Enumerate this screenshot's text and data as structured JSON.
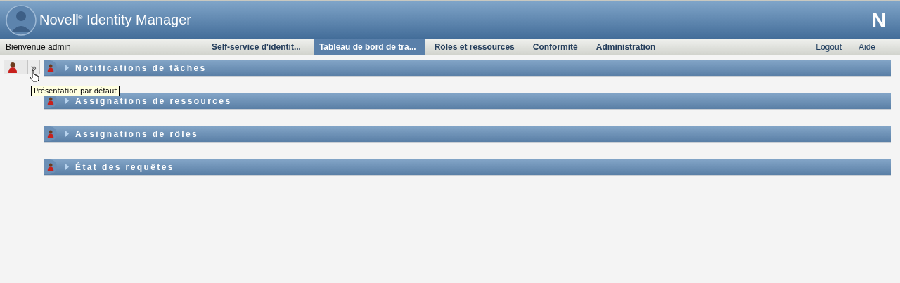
{
  "header": {
    "title": "Novell$^{®}$ Identity Manager",
    "logo_letter": "N"
  },
  "nav": {
    "welcome": "Bienvenue admin",
    "tabs": [
      {
        "label": "Self-service d'identit...",
        "selected": false
      },
      {
        "label": "Tableau de bord de tra...",
        "selected": true
      },
      {
        "label": "Rôles et ressources",
        "selected": false
      },
      {
        "label": "Conformité",
        "selected": false
      },
      {
        "label": "Administration",
        "selected": false
      }
    ],
    "links": [
      "Logout",
      "Aide"
    ]
  },
  "sidebar": {
    "expand_glyph": "»",
    "tooltip": "Présentation par défaut"
  },
  "panels": [
    {
      "title": "Notifications de tâches",
      "expanded": false
    },
    {
      "title": "Assignations de ressources",
      "expanded": false
    },
    {
      "title": "Assignations de rôles",
      "expanded": false
    },
    {
      "title": "État des requêtes",
      "expanded": false
    }
  ]
}
